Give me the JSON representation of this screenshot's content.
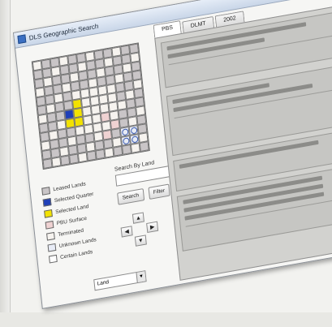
{
  "window": {
    "title": "DLS Geographic Search"
  },
  "grid": {
    "rows": 12,
    "cols": 12,
    "special": {
      "selected_quarter": [
        [
          6,
          3
        ]
      ],
      "selected_land": [
        [
          5,
          4
        ],
        [
          6,
          4
        ],
        [
          7,
          4
        ],
        [
          7,
          3
        ]
      ],
      "pink": [
        [
          7,
          7
        ],
        [
          8,
          8
        ],
        [
          9,
          7
        ]
      ],
      "circles": [
        [
          9,
          9
        ],
        [
          9,
          10
        ],
        [
          10,
          9
        ],
        [
          10,
          10
        ]
      ]
    }
  },
  "legend": {
    "items": [
      {
        "label": "Leased Lands",
        "color": "#c9c5c7"
      },
      {
        "label": "Selected Quarter",
        "color": "#1f3fb8"
      },
      {
        "label": "Selected Land",
        "color": "#f2e200"
      },
      {
        "label": "PBU Surface",
        "color": "#efd2d2"
      },
      {
        "label": "Terminated",
        "color": "#f6f3ef"
      },
      {
        "label": "Unknown Lands",
        "color": "#e8ecf6"
      },
      {
        "label": "Certain Lands",
        "color": "#ffffff"
      }
    ]
  },
  "search": {
    "caption": "Search By Land",
    "field_value": "",
    "search_label": "Search",
    "filter_label": "Filter"
  },
  "land": {
    "value": "Land"
  },
  "tabs": [
    "PBS",
    "DLMT",
    "2002"
  ]
}
